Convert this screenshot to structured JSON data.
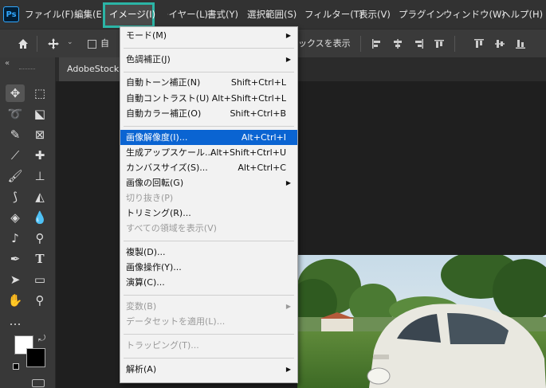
{
  "app": {
    "logo": "Ps"
  },
  "menubar": {
    "items": [
      "ファイル(F)",
      "編集(E",
      "イメージ(I)",
      "レイヤー(L)",
      "書式(Y)",
      "選択範囲(S)",
      "フィルター(T)",
      "表示(V)",
      "プラグイン",
      "ウィンドウ(W)",
      "ヘルプ(H)"
    ],
    "highlight_color": "#2bb5a6"
  },
  "options_bar": {
    "checkbox_label": "自",
    "transform_label": "ックスを表示"
  },
  "document": {
    "tab_title": "AdobeStock"
  },
  "image_menu": {
    "items": [
      {
        "label": "モード(M)",
        "shortcut": "",
        "submenu": true
      },
      {
        "label": "色調補正(J)",
        "shortcut": "",
        "submenu": true
      },
      {
        "label": "自動トーン補正(N)",
        "shortcut": "Shift+Ctrl+L"
      },
      {
        "label": "自動コントラスト(U)",
        "shortcut": "Alt+Shift+Ctrl+L"
      },
      {
        "label": "自動カラー補正(O)",
        "shortcut": "Shift+Ctrl+B"
      },
      {
        "label": "画像解像度(I)...",
        "shortcut": "Alt+Ctrl+I"
      },
      {
        "label": "生成アップスケール...",
        "shortcut": "Alt+Shift+Ctrl+U"
      },
      {
        "label": "カンバスサイズ(S)...",
        "shortcut": "Alt+Ctrl+C"
      },
      {
        "label": "画像の回転(G)",
        "shortcut": "",
        "submenu": true
      },
      {
        "label": "切り抜き(P)",
        "shortcut": "",
        "disabled": true
      },
      {
        "label": "トリミング(R)...",
        "shortcut": ""
      },
      {
        "label": "すべての領域を表示(V)",
        "shortcut": "",
        "disabled": true
      },
      {
        "label": "複製(D)...",
        "shortcut": ""
      },
      {
        "label": "画像操作(Y)...",
        "shortcut": ""
      },
      {
        "label": "演算(C)...",
        "shortcut": ""
      },
      {
        "label": "変数(B)",
        "shortcut": "",
        "submenu": true,
        "disabled": true
      },
      {
        "label": "データセットを適用(L)...",
        "shortcut": "",
        "disabled": true
      },
      {
        "label": "トラッピング(T)...",
        "shortcut": "",
        "disabled": true
      },
      {
        "label": "解析(A)",
        "shortcut": "",
        "submenu": true
      }
    ],
    "highlighted_color": "#0a64d2"
  }
}
